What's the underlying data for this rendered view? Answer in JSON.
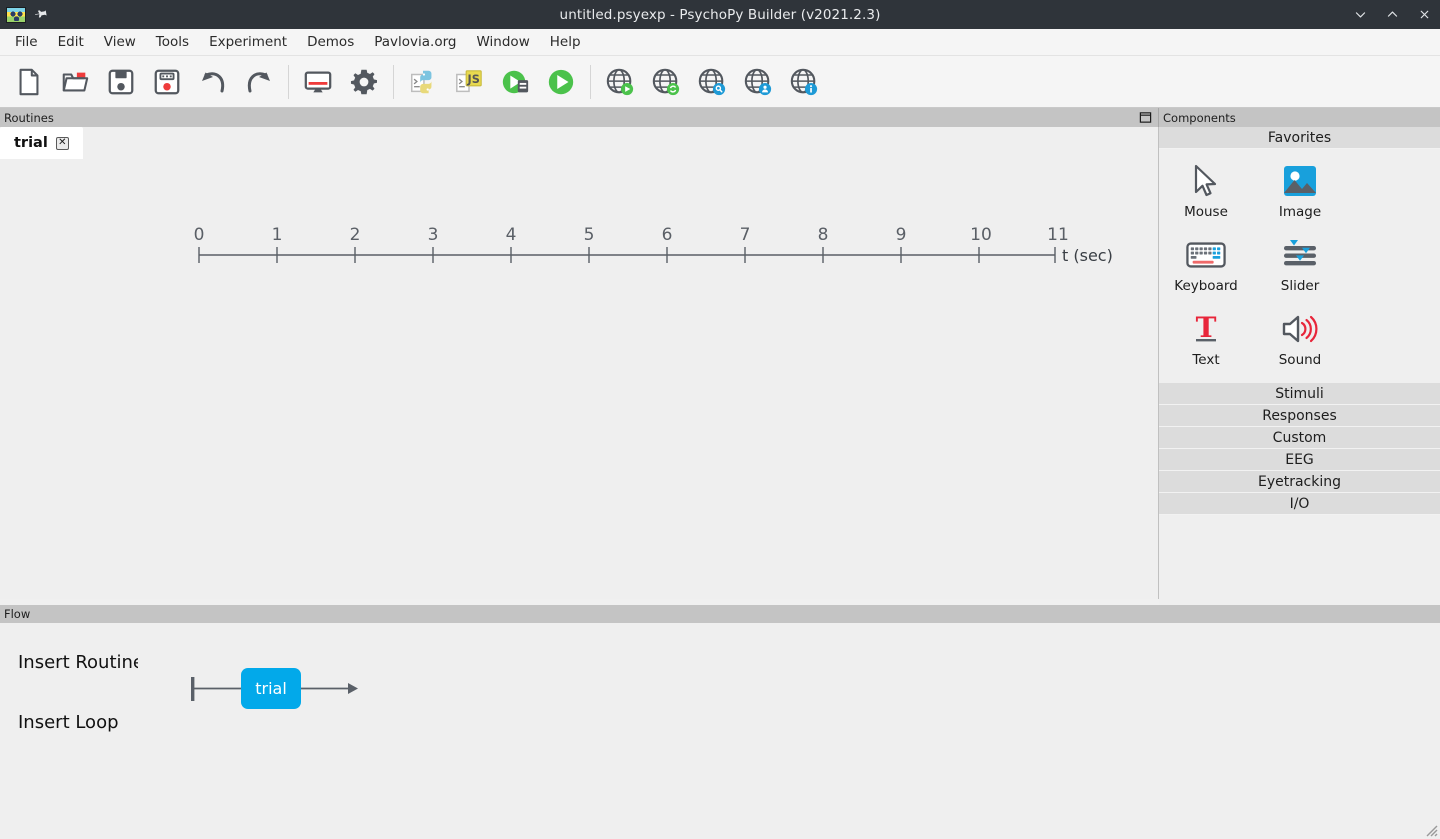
{
  "window": {
    "title": "untitled.psyexp - PsychoPy Builder (v2021.2.3)",
    "logo_name": "psychopy-logo",
    "pin_icon": "pin-icon",
    "controls": [
      {
        "name": "minimize-button",
        "glyph": "chevron-down-icon"
      },
      {
        "name": "maximize-button",
        "glyph": "chevron-up-icon"
      },
      {
        "name": "close-button",
        "glyph": "close-icon"
      }
    ]
  },
  "menubar": {
    "items": [
      {
        "label": "File"
      },
      {
        "label": "Edit"
      },
      {
        "label": "View"
      },
      {
        "label": "Tools"
      },
      {
        "label": "Experiment"
      },
      {
        "label": "Demos"
      },
      {
        "label": "Pavlovia.org"
      },
      {
        "label": "Window"
      },
      {
        "label": "Help"
      }
    ]
  },
  "toolbar": {
    "buttons": [
      {
        "name": "new-file-button",
        "icon": "new-document-icon"
      },
      {
        "name": "open-file-button",
        "icon": "open-folder-icon"
      },
      {
        "name": "save-button",
        "icon": "floppy-save-icon"
      },
      {
        "name": "save-as-button",
        "icon": "floppy-save-as-icon"
      },
      {
        "name": "undo-button",
        "icon": "undo-arrow-icon"
      },
      {
        "name": "redo-button",
        "icon": "redo-arrow-icon"
      },
      {
        "name": "monitor-center-button",
        "icon": "monitor-icon"
      },
      {
        "name": "experiment-settings-button",
        "icon": "gear-icon"
      },
      {
        "name": "compile-python-button",
        "icon": "python-script-icon"
      },
      {
        "name": "compile-javascript-button",
        "icon": "javascript-script-icon"
      },
      {
        "name": "run-server-button",
        "icon": "run-server-icon"
      },
      {
        "name": "run-experiment-button",
        "icon": "run-play-icon"
      },
      {
        "name": "pavlovia-run-button",
        "icon": "globe-play-icon"
      },
      {
        "name": "pavlovia-sync-button",
        "icon": "globe-sync-icon"
      },
      {
        "name": "pavlovia-search-button",
        "icon": "globe-search-icon"
      },
      {
        "name": "pavlovia-user-button",
        "icon": "globe-user-icon"
      },
      {
        "name": "pavlovia-info-button",
        "icon": "globe-info-icon"
      }
    ]
  },
  "routines": {
    "panel_title": "Routines",
    "dock_icon": "panel-restore-icon",
    "tabs": [
      {
        "label": "trial",
        "close_label": "✕"
      }
    ],
    "timeline": {
      "axis_label": "t (sec)",
      "ticks": [
        0,
        1,
        2,
        3,
        4,
        5,
        6,
        7,
        8,
        9,
        10,
        11
      ]
    }
  },
  "components": {
    "panel_title": "Components",
    "sections": [
      {
        "label": "Favorites",
        "items": [
          {
            "label": "Mouse",
            "icon": "mouse-cursor-icon"
          },
          {
            "label": "Image",
            "icon": "image-photo-icon"
          },
          {
            "label": "Keyboard",
            "icon": "keyboard-icon"
          },
          {
            "label": "Slider",
            "icon": "slider-icon"
          },
          {
            "label": "Text",
            "icon": "text-t-icon"
          },
          {
            "label": "Sound",
            "icon": "speaker-sound-icon"
          }
        ]
      },
      {
        "label": "Stimuli",
        "items": []
      },
      {
        "label": "Responses",
        "items": []
      },
      {
        "label": "Custom",
        "items": []
      },
      {
        "label": "EEG",
        "items": []
      },
      {
        "label": "Eyetracking",
        "items": []
      },
      {
        "label": "I/O",
        "items": []
      }
    ]
  },
  "flow": {
    "panel_title": "Flow",
    "insert_routine_label": "Insert Routine",
    "insert_loop_label": "Insert Loop",
    "nodes": [
      {
        "label": "trial",
        "type": "routine"
      }
    ]
  },
  "colors": {
    "titlebar_bg": "#2f343a",
    "panel_header_bg": "#c4c4c4",
    "canvas_bg": "#efefef",
    "routine_node": "#02a9ea",
    "accent_red": "#ef3b3b",
    "accent_green": "#4bc24b",
    "accent_blue": "#1e9ad6",
    "icon_gray": "#53585f"
  },
  "statusbar": {
    "resize_grip": "resize-grip-icon"
  }
}
